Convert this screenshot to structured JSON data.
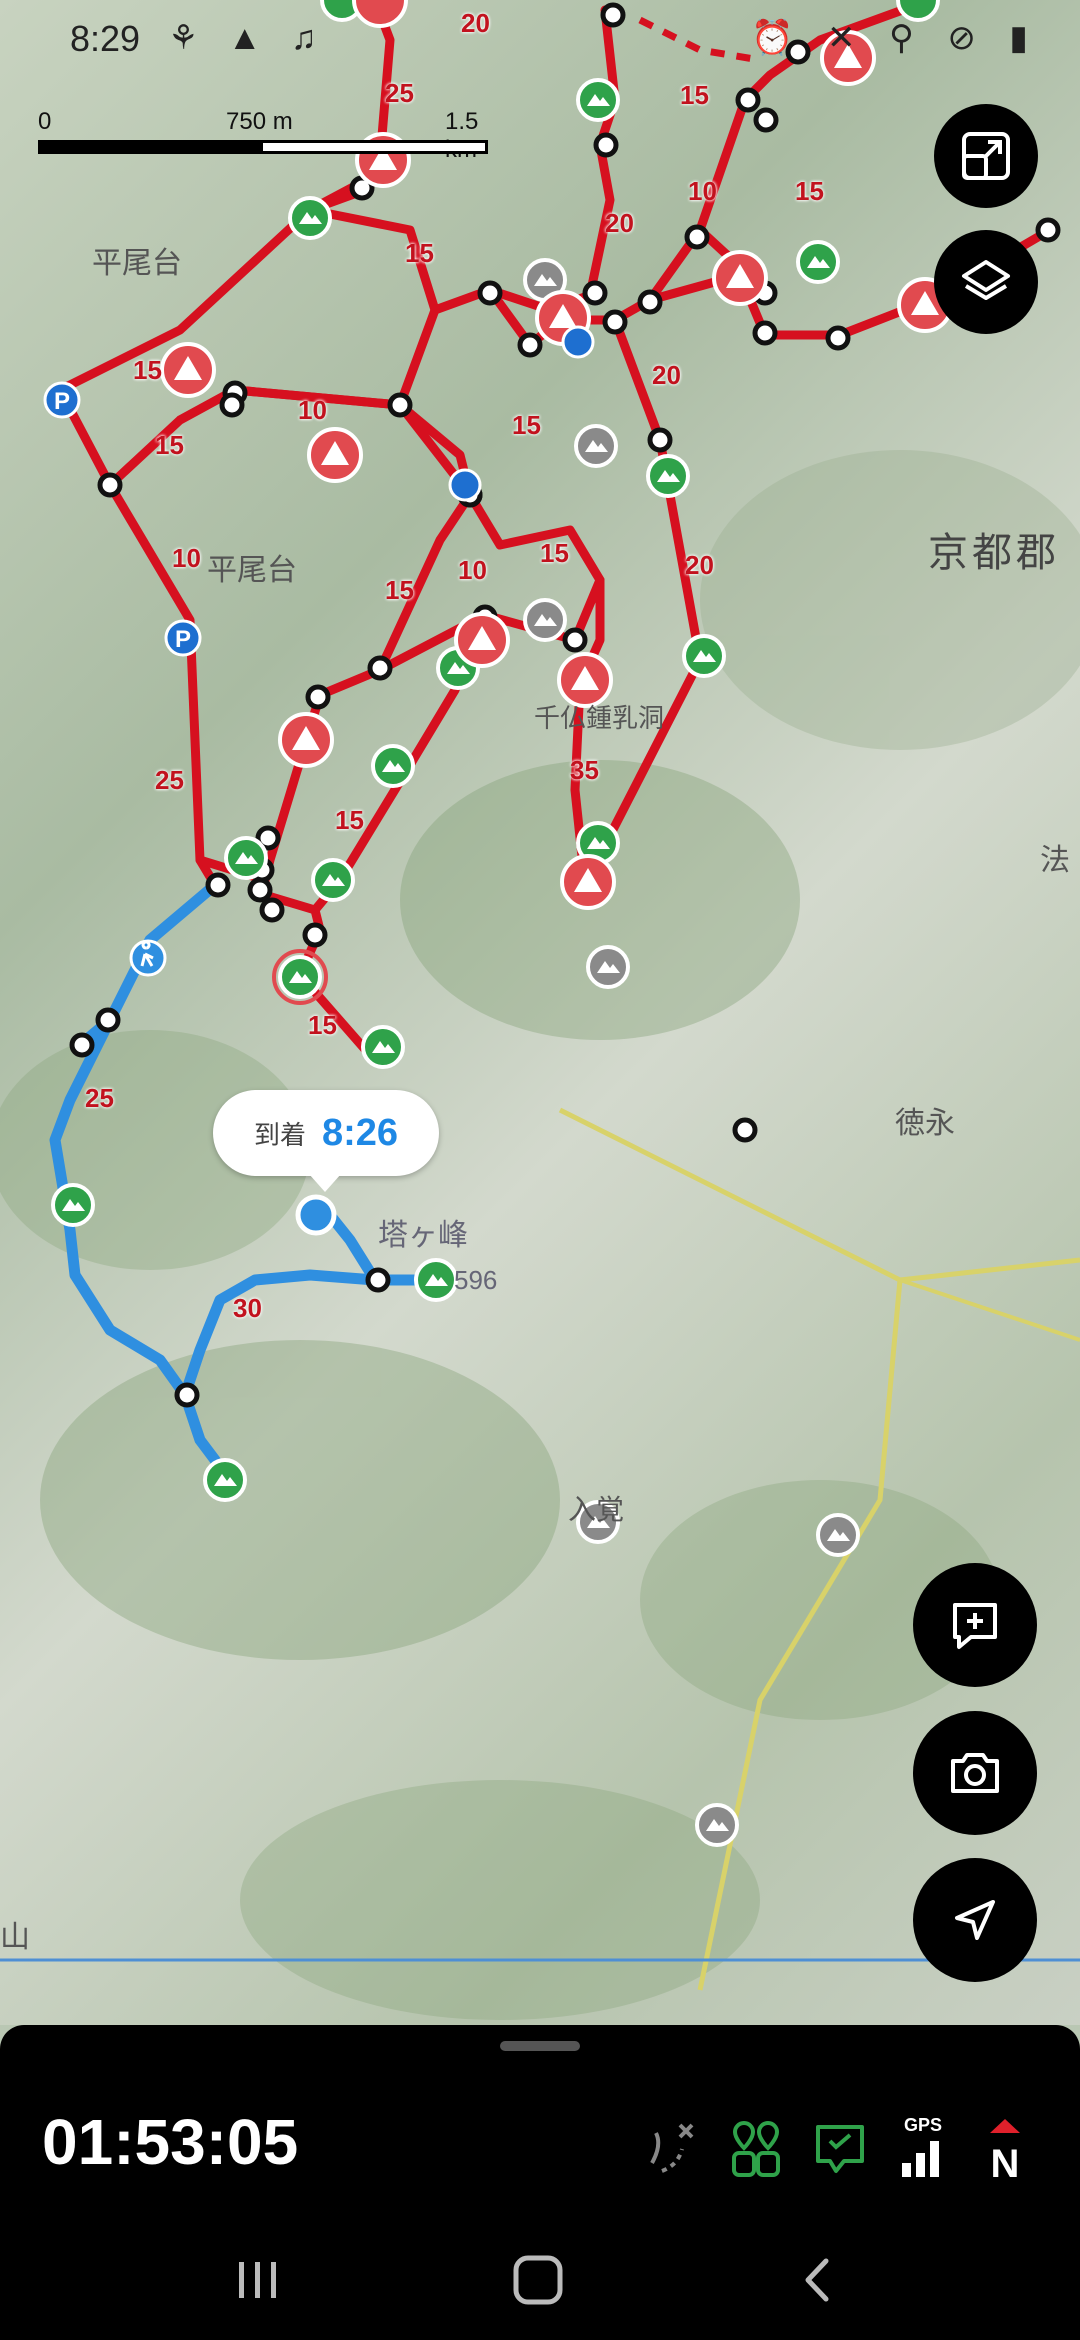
{
  "status_bar": {
    "time": "8:29",
    "left_icons": "⚘ ▲ ♫",
    "right_icons": "⏰ ✕ ⚲ ⊘ ▮"
  },
  "scale_bar": {
    "start": "0",
    "middle": "750 m",
    "end": "1.5 km"
  },
  "map": {
    "labels": [
      "平尾台",
      "平尾台",
      "京都郡",
      "徳永",
      "法",
      "千仏鍾乳洞",
      "塔ヶ峰",
      "596",
      "入覚",
      "山"
    ],
    "trail_numbers": [
      "20",
      "25",
      "15",
      "15",
      "10",
      "15",
      "20",
      "15",
      "10",
      "15",
      "15",
      "10",
      "20",
      "15",
      "15",
      "10",
      "15",
      "20",
      "25",
      "15",
      "35",
      "15",
      "25",
      "30"
    ]
  },
  "arrival_popup": {
    "label": "到着",
    "time": "8:26"
  },
  "fab": {
    "expand": "expand-map-icon",
    "layers": "layers-icon",
    "add_note": "add-note-icon",
    "camera": "camera-icon",
    "locate": "navigation-icon"
  },
  "bottom_panel": {
    "timer": "01:53:05",
    "gps_label": "GPS",
    "compass_label": "N"
  },
  "colors": {
    "trail_red": "#d6101f",
    "route_blue": "#2f8fe0",
    "poi_green": "#2fa24a",
    "warning_red": "#e14a4f"
  }
}
